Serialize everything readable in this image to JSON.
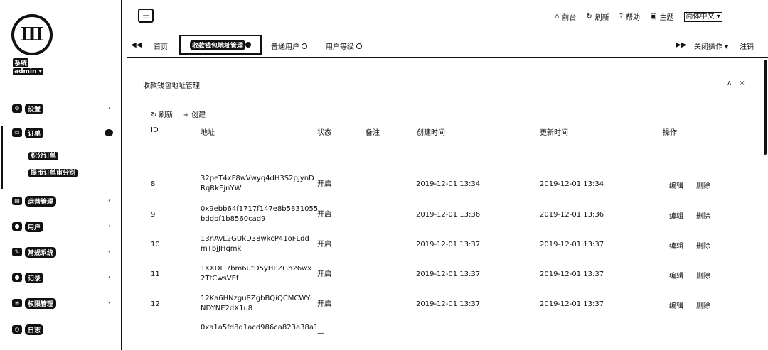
{
  "sidebar": {
    "logo": "Ш",
    "user_name": "系统",
    "user_role": "admin ▾",
    "items": [
      {
        "label": "设置",
        "icon": "gear-icon",
        "glyph": "⚙",
        "chev": "‹"
      },
      {
        "label": "订单",
        "icon": "monitor-icon",
        "glyph": "▭",
        "chev": ""
      },
      {
        "label": "运营管理",
        "icon": "chart-icon",
        "glyph": "▤",
        "chev": "‹"
      },
      {
        "label": "用户",
        "icon": "user-icon",
        "glyph": "●",
        "chev": "‹"
      },
      {
        "label": "常规系统",
        "icon": "edit-icon",
        "glyph": "✎",
        "chev": "‹"
      },
      {
        "label": "记录",
        "icon": "record-icon",
        "glyph": "●",
        "chev": "‹"
      },
      {
        "label": "权限管理",
        "icon": "list-icon",
        "glyph": "≡",
        "chev": "‹"
      },
      {
        "label": "日志",
        "icon": "clock-icon",
        "glyph": "◷",
        "chev": ""
      }
    ],
    "sub_items": [
      "积分订单",
      "提币订单审分别"
    ]
  },
  "topbar": {
    "hamburger": "☰",
    "links": [
      {
        "glyph": "⌂",
        "label": "前台"
      },
      {
        "glyph": "↻",
        "label": "刷新"
      },
      {
        "glyph": "?",
        "label": "帮助"
      },
      {
        "glyph": "▣",
        "label": "主题"
      }
    ],
    "language": "简体中文 ▾"
  },
  "tabs": {
    "left_arrow": "◀◀",
    "home": "首页",
    "active": "收款钱包地址管理",
    "others": [
      "普通用户",
      "用户等级"
    ],
    "right_arrow": "▶▶",
    "ops": "关闭操作 ▾",
    "logout": "注销"
  },
  "panel": {
    "title": "收款钱包地址管理",
    "collapse": "∧",
    "close": "×",
    "refresh": "↻ 刷新",
    "create": "+ 创建"
  },
  "table": {
    "headers": [
      "ID",
      "地址",
      "状态",
      "备注",
      "创建时间",
      "更新时间",
      "操作"
    ],
    "rows": [
      {
        "id": "8",
        "address_1": "32peT4xF8wVwyq4dH3S2pJynD",
        "address_2": "RqRkEjnYW",
        "status": "开启",
        "note": "",
        "created": "2019-12-01 13:34",
        "updated": "2019-12-01 13:34",
        "edit": "编辑",
        "delete": "删除"
      },
      {
        "id": "9",
        "address_1": "0x9ebb64f1717f147e8b5831055",
        "address_2": "bddbf1b8560cad9",
        "status": "开启",
        "note": "",
        "created": "2019-12-01 13:36",
        "updated": "2019-12-01 13:36",
        "edit": "编辑",
        "delete": "删除"
      },
      {
        "id": "10",
        "address_1": "13nAvL2GUkD38wkcP41oFLdd",
        "address_2": "mTbjJHqmk",
        "status": "开启",
        "note": "",
        "created": "2019-12-01 13:37",
        "updated": "2019-12-01 13:37",
        "edit": "编辑",
        "delete": "删除"
      },
      {
        "id": "11",
        "address_1": "1KXDLi7bm6utD5yHPZGh26wx",
        "address_2": "2TtCwsVEf",
        "status": "开启",
        "note": "",
        "created": "2019-12-01 13:37",
        "updated": "2019-12-01 13:37",
        "edit": "编辑",
        "delete": "删除"
      },
      {
        "id": "12",
        "address_1": "12Ka6HNzgu8ZgbBQiQCMCWY",
        "address_2": "NDYNE2dX1u8",
        "status": "开启",
        "note": "",
        "created": "2019-12-01 13:37",
        "updated": "2019-12-01 13:37",
        "edit": "编辑",
        "delete": "删除"
      },
      {
        "id": "",
        "address_1": "0xa1a5fd8d1acd986ca823a38a1",
        "address_2": "",
        "status": "—",
        "note": "",
        "created": "",
        "updated": "",
        "edit": "",
        "delete": ""
      }
    ]
  }
}
